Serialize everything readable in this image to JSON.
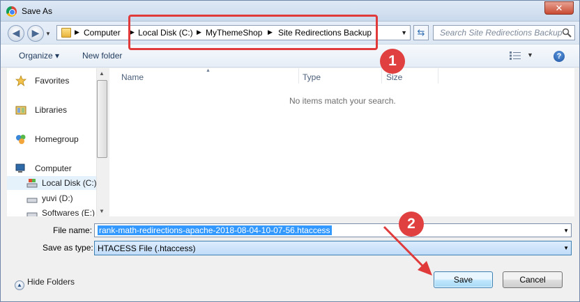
{
  "window": {
    "title": "Save As"
  },
  "address": {
    "crumbs": [
      "Computer",
      "Local Disk (C:)",
      "MyThemeShop",
      "Site Redirections Backup"
    ],
    "search_placeholder": "Search Site Redirections Backup"
  },
  "toolbar": {
    "organize_label": "Organize ▾",
    "new_folder_label": "New folder"
  },
  "annotations": {
    "badge_1": "1",
    "badge_2": "2",
    "color": "#e03a3a"
  },
  "nav": {
    "items": [
      {
        "label": "Favorites",
        "icon": "star-icon"
      },
      {
        "label": "Libraries",
        "icon": "library-icon"
      },
      {
        "label": "Homegroup",
        "icon": "homegroup-icon"
      },
      {
        "label": "Computer",
        "icon": "computer-icon"
      },
      {
        "label": "Local Disk (C:)",
        "icon": "drive-icon"
      },
      {
        "label": "yuvi (D:)",
        "icon": "drive-icon"
      },
      {
        "label": "Softwares (E:)",
        "icon": "drive-icon"
      }
    ]
  },
  "content": {
    "columns": [
      "Name",
      "Type",
      "Size"
    ],
    "empty_message": "No items match your search."
  },
  "form": {
    "file_name_label": "File name:",
    "file_name_value": "rank-math-redirections-apache-2018-08-04-10-07-56.htaccess",
    "save_type_label": "Save as type:",
    "save_type_value": "HTACESS File (.htaccess)"
  },
  "footer": {
    "hide_folders_label": "Hide Folders",
    "save_label": "Save",
    "cancel_label": "Cancel"
  }
}
